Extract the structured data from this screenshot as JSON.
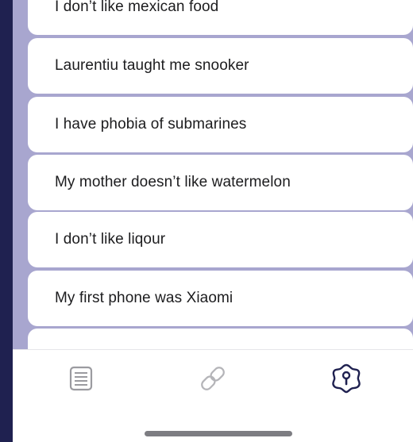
{
  "items": [
    {
      "label": "I don’t like mexican food"
    },
    {
      "label": "Laurentiu taught me snooker"
    },
    {
      "label": "I have phobia of submarines"
    },
    {
      "label": "My mother doesn’t like watermelon"
    },
    {
      "label": "I don’t like liqour"
    },
    {
      "label": "My first phone was Xiaomi"
    },
    {
      "label": ""
    }
  ],
  "tabs": [
    {
      "icon": "document-list-icon",
      "active": false
    },
    {
      "icon": "link-icon",
      "active": false
    },
    {
      "icon": "keyhole-badge-icon",
      "active": true
    }
  ],
  "colors": {
    "background": "#a8a6cf",
    "frame": "#1f2150",
    "active_icon": "#1f2150",
    "inactive_icon": "#9b9ba0"
  }
}
